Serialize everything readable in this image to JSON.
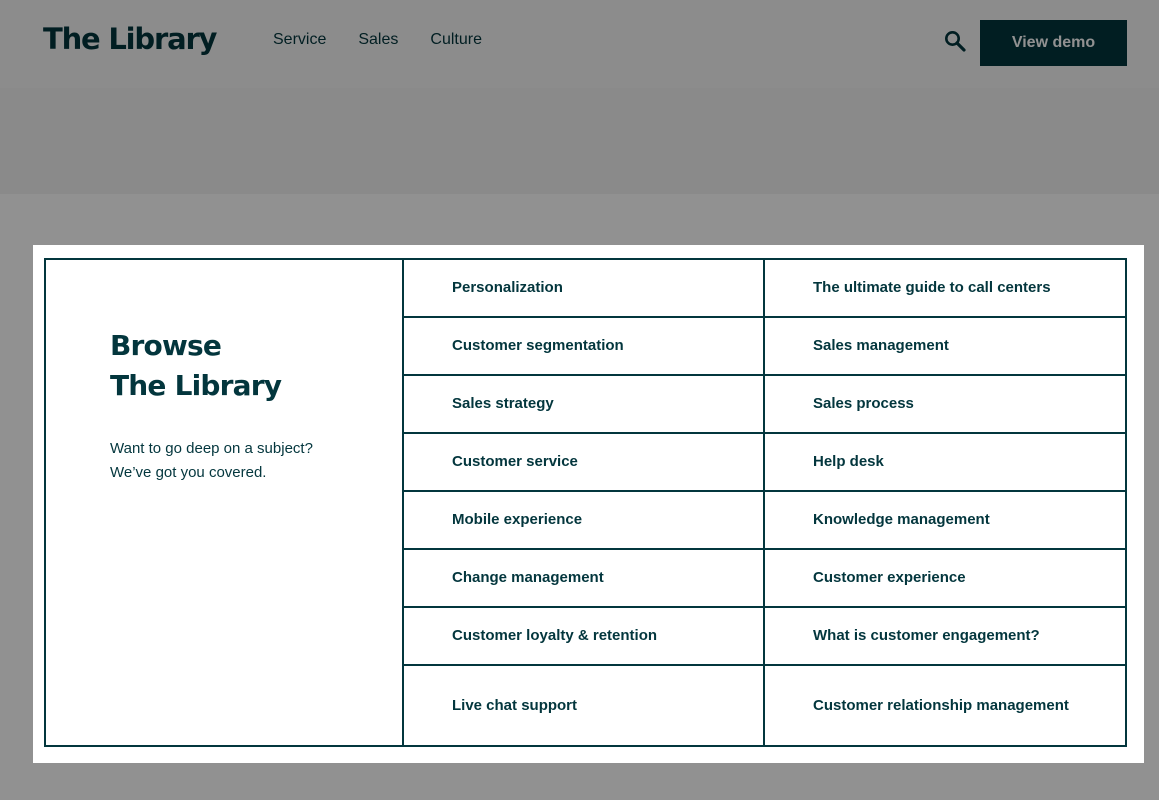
{
  "header": {
    "logo": "The Library",
    "nav": [
      "Service",
      "Sales",
      "Culture"
    ],
    "search_icon": "search-icon",
    "demo_label": "View demo"
  },
  "modal": {
    "title_line1": "Browse",
    "title_line2": "The Library",
    "text_line1": "Want to go deep on a subject?",
    "text_line2": "We’ve got you covered.",
    "topics": [
      "Personalization",
      "The ultimate guide to call centers",
      "Customer segmentation",
      "Sales management",
      "Sales strategy",
      "Sales process",
      "Customer service",
      "Help desk",
      "Mobile experience",
      "Knowledge management",
      "Change management",
      "Customer experience",
      "Customer loyalty & retention",
      "What is customer engagement?",
      "Live chat support",
      "Customer relationship management"
    ]
  },
  "colors": {
    "brand": "#03363d",
    "overlay": "rgba(0,0,0,0.43)",
    "background": "#ffffff"
  }
}
